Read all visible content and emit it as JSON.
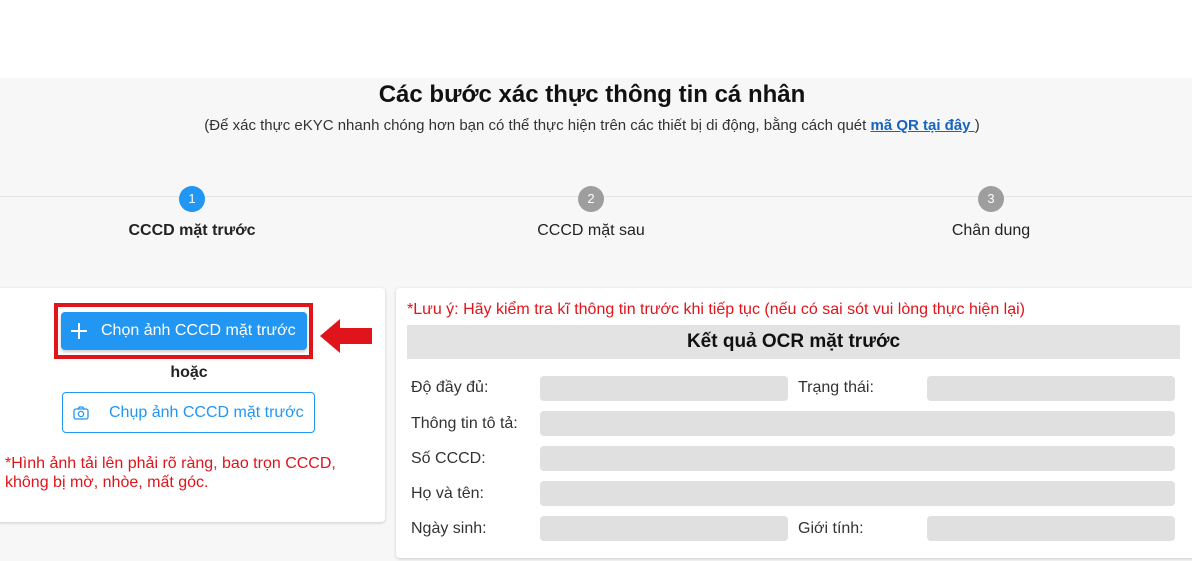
{
  "header": {
    "title": "Các bước xác thực thông tin cá nhân",
    "subtitle_prefix": "(Để xác thực eKYC nhanh chóng hơn bạn có thể thực hiện trên các thiết bị di động, bằng cách quét ",
    "qr_link": "mã QR tại đây ",
    "subtitle_suffix": ")"
  },
  "steps": [
    {
      "number": "1",
      "label": "CCCD mặt trước",
      "active": true
    },
    {
      "number": "2",
      "label": "CCCD mặt sau",
      "active": false
    },
    {
      "number": "3",
      "label": "Chân dung",
      "active": false
    }
  ],
  "upload": {
    "choose_label": "Chọn ảnh CCCD mặt trước",
    "or_label": "hoặc",
    "capture_label": "Chụp ảnh CCCD mặt trước",
    "note": "*Hình ảnh tải lên phải rõ ràng, bao trọn CCCD, không bị mờ, nhòe, mất góc."
  },
  "ocr": {
    "note": "*Lưu ý: Hãy kiểm tra kĩ thông tin trước khi tiếp tục (nếu có sai sót vui lòng thực hiện lại)",
    "title": "Kết quả OCR mặt trước",
    "fields": {
      "completeness": {
        "label": "Độ đầy đủ:",
        "value": ""
      },
      "status": {
        "label": "Trạng thái:",
        "value": ""
      },
      "description": {
        "label": "Thông tin tô tả:",
        "value": ""
      },
      "id_number": {
        "label": "Số CCCD:",
        "value": ""
      },
      "full_name": {
        "label": "Họ và tên:",
        "value": ""
      },
      "dob": {
        "label": "Ngày sinh:",
        "value": ""
      },
      "gender": {
        "label": "Giới tính:",
        "value": ""
      }
    }
  },
  "colors": {
    "primary": "#2196f3",
    "alert": "#e0141b",
    "link": "#1565c0",
    "inactive_step": "#9e9e9e"
  }
}
